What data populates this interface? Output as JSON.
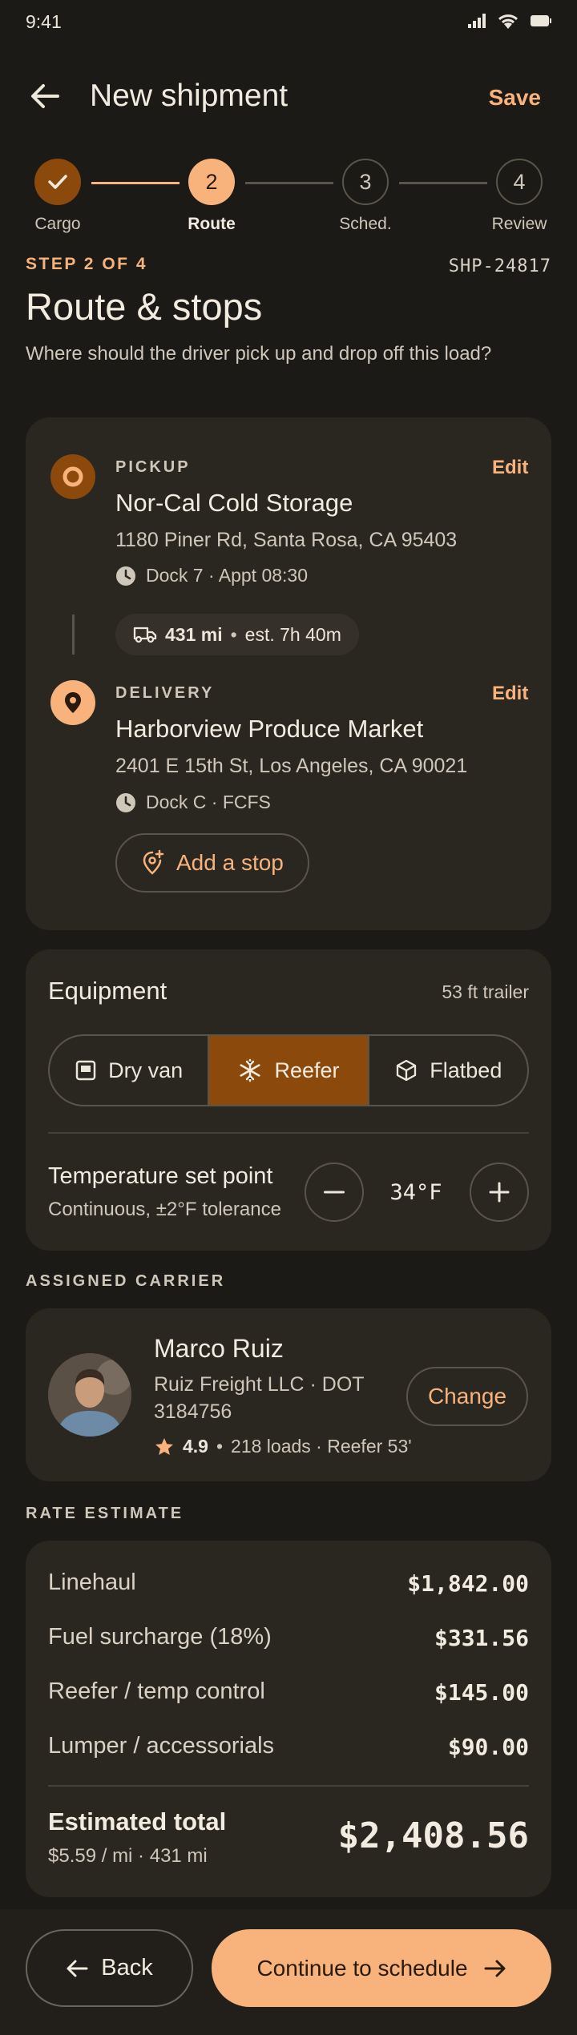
{
  "status": {
    "time": "9:41"
  },
  "header": {
    "title": "New shipment",
    "save_label": "Save"
  },
  "stepper": {
    "steps": [
      {
        "label": "Cargo",
        "number": "",
        "state": "done"
      },
      {
        "label": "Route",
        "number": "2",
        "state": "active"
      },
      {
        "label": "Sched.",
        "number": "3",
        "state": "todo"
      },
      {
        "label": "Review",
        "number": "4",
        "state": "todo"
      }
    ]
  },
  "section": {
    "step_of": "STEP 2 OF 4",
    "shipment_id": "SHP-24817",
    "title": "Route & stops",
    "subtitle": "Where should the driver pick up and drop off this load?"
  },
  "route": {
    "pickup": {
      "kind": "PICKUP",
      "edit_label": "Edit",
      "name": "Nor-Cal Cold Storage",
      "address": "1180 Piner Rd, Santa Rosa, CA 95403",
      "meta": "Dock 7 · Appt 08:30"
    },
    "leg": {
      "distance": "431 mi",
      "duration": "est. 7h 40m"
    },
    "delivery": {
      "kind": "DELIVERY",
      "edit_label": "Edit",
      "name": "Harborview Produce Market",
      "address": "2401 E 15th St, Los Angeles, CA 90021",
      "meta": "Dock C · FCFS"
    },
    "add_stop_label": "Add a stop"
  },
  "equipment": {
    "title": "Equipment",
    "size": "53 ft trailer",
    "options": [
      {
        "label": "Dry van",
        "icon": "box-icon",
        "selected": false
      },
      {
        "label": "Reefer",
        "icon": "snowflake-icon",
        "selected": true
      },
      {
        "label": "Flatbed",
        "icon": "cube-icon",
        "selected": false
      }
    ],
    "temp_label": "Temperature set point",
    "temp_sub": "Continuous, ±2°F tolerance",
    "temp_value": "34°F"
  },
  "carrier": {
    "heading": "ASSIGNED CARRIER",
    "name": "Marco Ruiz",
    "company": "Ruiz Freight LLC · DOT 3184756",
    "rating": "4.9",
    "details": "218 loads · Reefer 53'",
    "change_label": "Change"
  },
  "rate": {
    "heading": "RATE ESTIMATE",
    "rows": [
      {
        "label": "Linehaul",
        "value": "$1,842.00"
      },
      {
        "label": "Fuel surcharge (18%)",
        "value": "$331.56"
      },
      {
        "label": "Reefer / temp control",
        "value": "$145.00"
      },
      {
        "label": "Lumper / accessorials",
        "value": "$90.00"
      }
    ],
    "total_label": "Estimated total",
    "total_sub": "$5.59 / mi · 431 mi",
    "total_value": "$2,408.56"
  },
  "footer": {
    "back_label": "Back",
    "continue_label": "Continue to schedule"
  },
  "colors": {
    "accent": "#f8b37c",
    "accent_dark": "#8b4a0c",
    "background": "#1c1a16",
    "card": "#2a2620"
  }
}
